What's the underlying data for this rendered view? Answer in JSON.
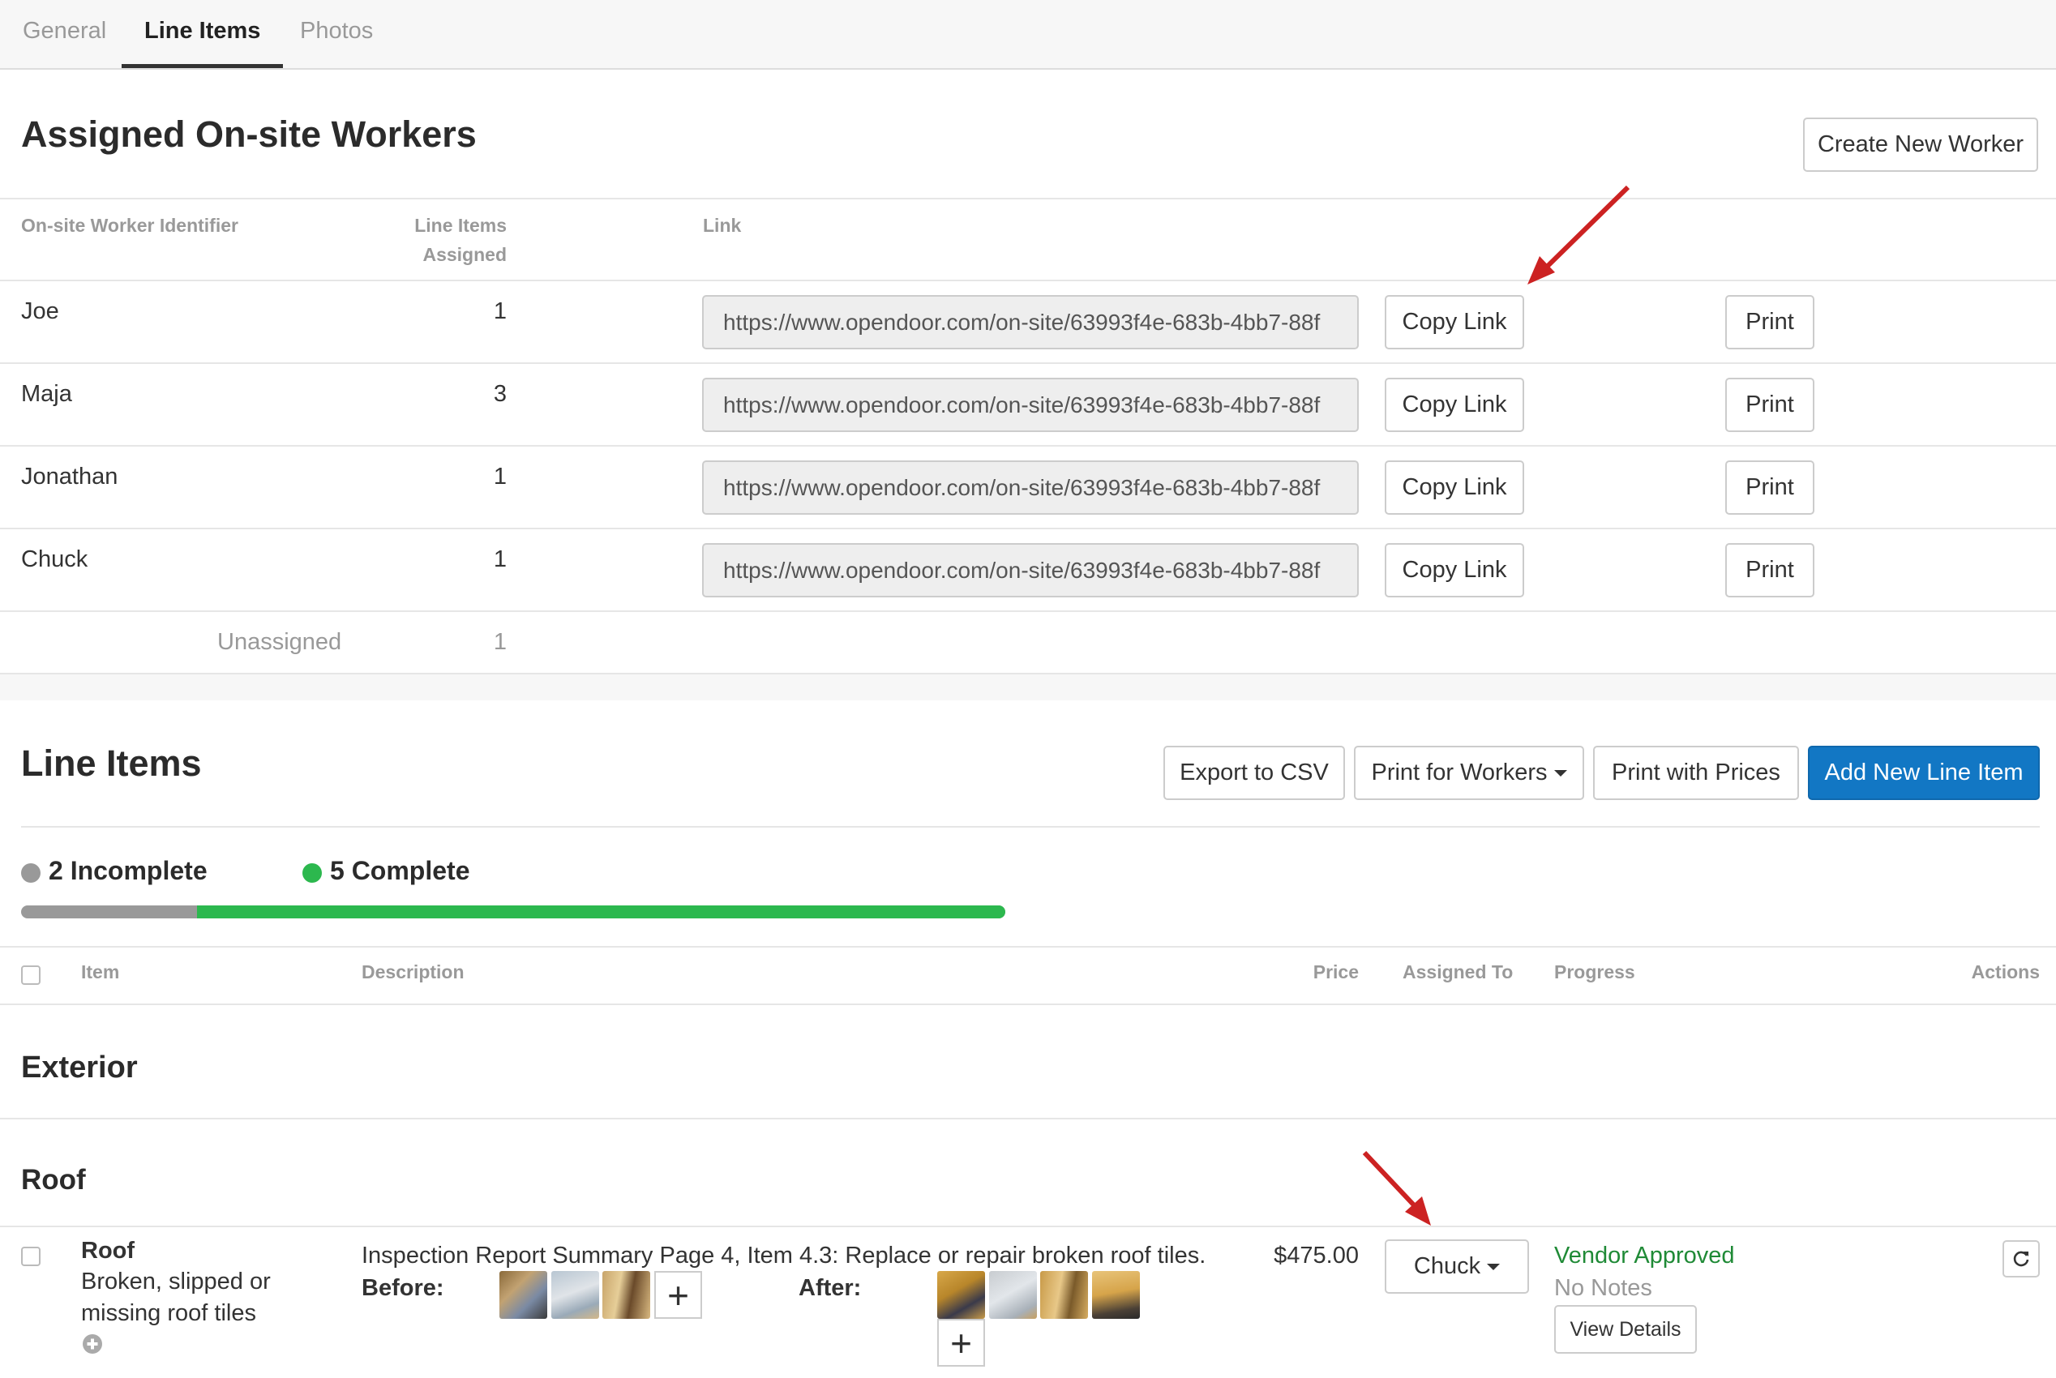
{
  "tabs": [
    "General",
    "Line Items",
    "Photos"
  ],
  "workers_section": {
    "title": "Assigned On-site Workers",
    "create_button": "Create New Worker",
    "columns": {
      "identifier": "On-site Worker Identifier",
      "assigned_line1": "Line Items",
      "assigned_line2": "Assigned",
      "link": "Link"
    },
    "rows": [
      {
        "name": "Joe",
        "count": "1",
        "link": "https://www.opendoor.com/on-site/63993f4e-683b-4bb7-88f",
        "copy": "Copy Link",
        "print": "Print"
      },
      {
        "name": "Maja",
        "count": "3",
        "link": "https://www.opendoor.com/on-site/63993f4e-683b-4bb7-88f",
        "copy": "Copy Link",
        "print": "Print"
      },
      {
        "name": "Jonathan",
        "count": "1",
        "link": "https://www.opendoor.com/on-site/63993f4e-683b-4bb7-88f",
        "copy": "Copy Link",
        "print": "Print"
      },
      {
        "name": "Chuck",
        "count": "1",
        "link": "https://www.opendoor.com/on-site/63993f4e-683b-4bb7-88f",
        "copy": "Copy Link",
        "print": "Print"
      }
    ],
    "unassigned": {
      "label": "Unassigned",
      "count": "1"
    }
  },
  "line_items_section": {
    "title": "Line Items",
    "buttons": {
      "export": "Export to CSV",
      "print_workers": "Print for Workers",
      "print_prices": "Print with Prices",
      "add": "Add New Line Item"
    },
    "status": {
      "incomplete": "2 Incomplete",
      "complete": "5 Complete",
      "incomplete_count": 2,
      "complete_count": 5
    },
    "colors": {
      "incomplete": "#999999",
      "complete": "#2cb84e",
      "primary": "#1277c4",
      "arrow": "#cc2222"
    },
    "columns": {
      "item": "Item",
      "description": "Description",
      "price": "Price",
      "assigned_to": "Assigned To",
      "progress": "Progress",
      "actions": "Actions"
    },
    "category": "Exterior",
    "subcategory": "Roof",
    "item": {
      "name": "Roof",
      "subtitle_line1": "Broken, slipped or",
      "subtitle_line2": "missing roof tiles",
      "description": "Inspection Report Summary Page 4, Item 4.3: Replace or repair broken roof tiles.",
      "before_label": "Before:",
      "after_label": "After:",
      "price": "$475.00",
      "assignee": "Chuck",
      "progress_status": "Vendor Approved",
      "notes": "No Notes",
      "details_button": "View Details",
      "add_symbol": "+"
    }
  },
  "icons": [
    "plus-circle-icon",
    "refresh-icon",
    "caret-down-icon",
    "annotation-arrow"
  ]
}
